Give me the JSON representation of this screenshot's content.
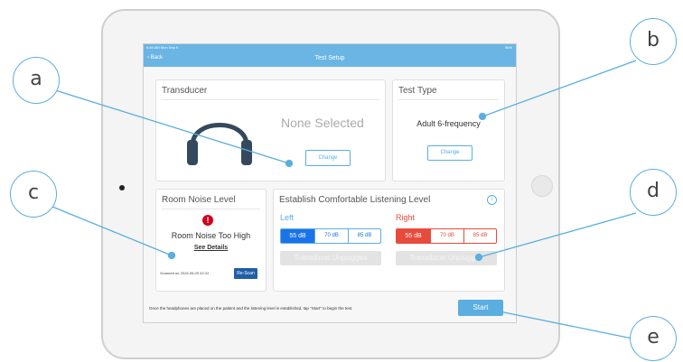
{
  "colors": {
    "accent": "#5aaee0",
    "danger": "#e84a3c",
    "dark_button": "#1f5fa6",
    "headphone": "#34495e"
  },
  "status_bar": {
    "time": "8:49 AM  Mon Sep 9",
    "battery": "96%"
  },
  "nav": {
    "back_label": "Back",
    "title": "Test Setup"
  },
  "transducer": {
    "title": "Transducer",
    "selection": "None Selected",
    "change_label": "Change",
    "icon": "headphones-icon"
  },
  "test_type": {
    "title": "Test Type",
    "value": "Adult 6-frequency",
    "change_label": "Change"
  },
  "room_noise": {
    "title": "Room Noise Level",
    "warning_icon": "!",
    "status": "Room Noise Too High",
    "details_link": "See Details",
    "scanned": "Scanned on 2019-09-05 03:33",
    "rescan_label": "Re-Scan"
  },
  "listening": {
    "title": "Establish Comfortable Listening Level",
    "info_icon": "i",
    "left": {
      "label": "Left",
      "options": [
        "55 dB",
        "70 dB",
        "85 dB"
      ],
      "selected": "55 dB",
      "status": "Transducer Unplugged"
    },
    "right": {
      "label": "Right",
      "options": [
        "55 dB",
        "70 dB",
        "85 dB"
      ],
      "selected": "55 dB",
      "status": "Transducer Unplugged"
    }
  },
  "footer": {
    "instructions": "Once the headphones are placed on the patient and the listening level is established, tap \"Start\" to begin the test.",
    "start_label": "Start"
  },
  "callouts": [
    "a",
    "b",
    "c",
    "d",
    "e"
  ]
}
